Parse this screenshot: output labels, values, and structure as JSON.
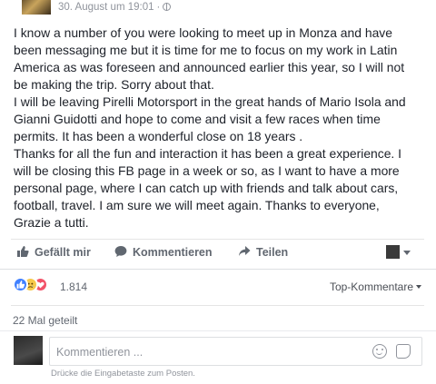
{
  "header": {
    "timestamp": "30. August um 19:01",
    "separator": "·"
  },
  "post": {
    "lines": [
      "I know a number of you were looking to meet up in Monza and have",
      "been messaging me but it is time for me to focus on my work in Latin",
      "America as was foreseen and announced earlier this year, so I will not",
      "be making the trip. Sorry about that.",
      "I will be leaving Pirelli Motorsport in the great hands of Mario Isola and",
      "Gianni Guidotti and hope to come and visit a few races when time",
      "permits. It has been a wonderful close on 18 years .",
      "Thanks for all the fun and interaction it has been a great experience. I",
      "will be closing this FB page in a week or so, as I want to have a more",
      "personal page, where I can catch up with friends and talk about cars,",
      "football, travel. I am sure we will meet again. Thanks to everyone,",
      "Grazie a tutti."
    ]
  },
  "actions": {
    "like_label": "Gefällt mir",
    "comment_label": "Kommentieren",
    "share_label": "Teilen"
  },
  "reactions": {
    "count": "1.814",
    "types": [
      "like-icon",
      "sad-icon",
      "love-icon"
    ],
    "colors": {
      "like": "#4080ff",
      "sad": "#f7c94a",
      "love": "#f25268"
    }
  },
  "comments_sort": {
    "label": "Top-Kommentare"
  },
  "shares": {
    "label": "22 Mal geteilt"
  },
  "composer": {
    "placeholder": "Kommentieren ...",
    "hint": "Drücke die Eingabetaste zum Posten."
  }
}
